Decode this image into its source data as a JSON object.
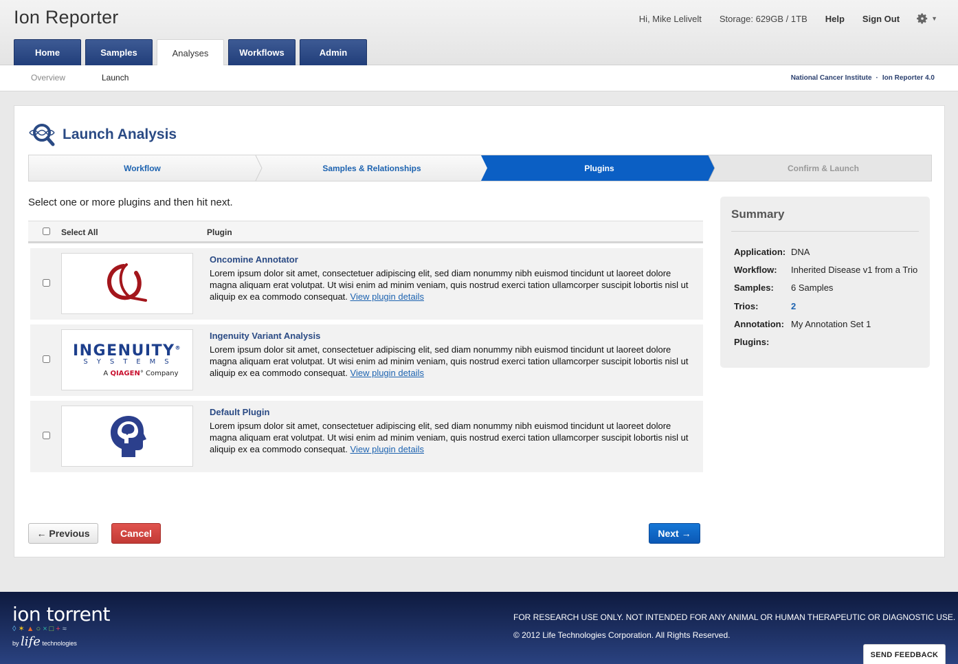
{
  "app": {
    "title": "Ion Reporter"
  },
  "userbar": {
    "greeting": "Hi, Mike Lelivelt",
    "storage": "Storage: 629GB / 1TB",
    "help": "Help",
    "sign_out": "Sign Out"
  },
  "tabs": [
    "Home",
    "Samples",
    "Analyses",
    "Workflows",
    "Admin"
  ],
  "active_tab": "Analyses",
  "subnav": {
    "overview": "Overview",
    "launch": "Launch",
    "org": "National Cancer Institute",
    "version": "Ion Reporter 4.0"
  },
  "page": {
    "title": "Launch Analysis",
    "instruction": "Select one or more plugins and then hit next."
  },
  "wizard": {
    "steps": [
      "Workflow",
      "Samples & Relationships",
      "Plugins",
      "Confirm & Launch"
    ],
    "active": "Plugins"
  },
  "table": {
    "select_all": "Select All",
    "plugin_header": "Plugin"
  },
  "plugins": [
    {
      "name": "Oncomine Annotator",
      "desc": "Lorem ipsum dolor sit amet, consectetuer adipiscing elit, sed diam nonummy nibh euismod tincidunt ut laoreet dolore magna aliquam erat volutpat. Ut wisi enim ad minim veniam, quis nostrud exerci tation ullamcorper suscipit lobortis nisl ut aliquip ex ea commodo consequat.",
      "link": "View plugin details"
    },
    {
      "name": "Ingenuity Variant Analysis",
      "desc": "Lorem ipsum dolor sit amet, consectetuer adipiscing elit, sed diam nonummy nibh euismod tincidunt ut laoreet dolore magna aliquam erat volutpat. Ut wisi enim ad minim veniam, quis nostrud exerci tation ullamcorper suscipit lobortis nisl ut aliquip ex ea commodo consequat.",
      "link": "View plugin details"
    },
    {
      "name": "Default Plugin",
      "desc": "Lorem ipsum dolor sit amet, consectetuer adipiscing elit, sed diam nonummy nibh euismod tincidunt ut laoreet dolore magna aliquam erat volutpat. Ut wisi enim ad minim veniam, quis nostrud exerci tation ullamcorper suscipit lobortis nisl ut aliquip ex ea commodo consequat.",
      "link": "View plugin details"
    }
  ],
  "ingenuity_logo": {
    "word": "INGENUITY",
    "reg": "®",
    "systems": "SYSTEMS",
    "company_prefix": "A ",
    "company_brand": "QIAGEN",
    "company_suffix": "° Company"
  },
  "summary": {
    "title": "Summary",
    "rows": [
      {
        "key": "Application:",
        "value": "DNA"
      },
      {
        "key": "Workflow:",
        "value": "Inherited Disease v1 from a Trio"
      },
      {
        "key": "Samples:",
        "value": "6 Samples"
      },
      {
        "key": "Trios:",
        "value": "2"
      },
      {
        "key": "Annotation:",
        "value": "My Annotation Set 1"
      },
      {
        "key": "Plugins:",
        "value": ""
      }
    ]
  },
  "buttons": {
    "previous": "← Previous",
    "cancel": "Cancel",
    "next": "Next →"
  },
  "footer": {
    "brand": "ion torrent",
    "brand_by": "by",
    "brand_life": "life",
    "brand_tech": "technologies",
    "legal1": "FOR RESEARCH USE ONLY. NOT INTENDED FOR ANY ANIMAL OR HUMAN THERAPEUTIC OR DIAGNOSTIC USE.",
    "legal2": "© 2012 Life Technologies Corporation. All Rights Reserved.",
    "feedback": "SEND FEEDBACK"
  },
  "colors": {
    "brand_blue": "#2a4a84",
    "accent_blue": "#0b5fc4",
    "cancel_red": "#c23a35",
    "footer_navy": "#13224d"
  },
  "icons": [
    "launch-analysis-icon",
    "gear-icon",
    "oncomine-logo",
    "ingenuity-logo",
    "default-plugin-head-icon",
    "ion-torrent-logo"
  ]
}
